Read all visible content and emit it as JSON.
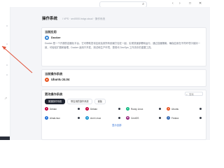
{
  "header": {
    "search_icon": "search-icon",
    "controls": [
      "‹",
      "›",
      "□",
      "✕"
    ]
  },
  "page": {
    "title": "操作系统",
    "breadcrumb": "/ VPS · srv0000.hstgr.cloud · 操作系统"
  },
  "current_app": {
    "heading": "当前应用",
    "name": "Docker",
    "logo_color": "#2a7fd4",
    "description": "Docker 是一个开源的容器化平台，它可帮助您将应用及其所有依赖打包在一起，实现快速部署和运行。通过容器隔离，确保应用在不同环境中保持一致，可轻松扩展和管理。Docker 适用于开发、测试和生产环境，是现代 DevOps 工作流中的重要工具。"
  },
  "current_os": {
    "heading": "当前操作系统",
    "name": "Ubuntu 24.04",
    "logo_color": "#e95420"
  },
  "change_os": {
    "heading": "更改操作系统",
    "search_placeholder": "搜索",
    "tabs": [
      "普通操作系统",
      "带应用的操作系统",
      "面板"
    ],
    "active_tab": 0,
    "items": [
      {
        "name": "Debian",
        "color": "#c7003a"
      },
      {
        "name": "Debian",
        "color": "#c7003a"
      },
      {
        "name": "Rocky Linux",
        "color": "#10b981"
      },
      {
        "name": "Ubuntu",
        "color": "#e95420"
      },
      {
        "name": "AlmaLinux",
        "color": "#1f6fd6"
      },
      {
        "name": "Arch Linux",
        "color": "#1793d1"
      },
      {
        "name": "CentOS",
        "color": "#932279"
      },
      {
        "name": "Fedora",
        "color": "#3c6eb4"
      }
    ],
    "more_link": "显示全部"
  }
}
